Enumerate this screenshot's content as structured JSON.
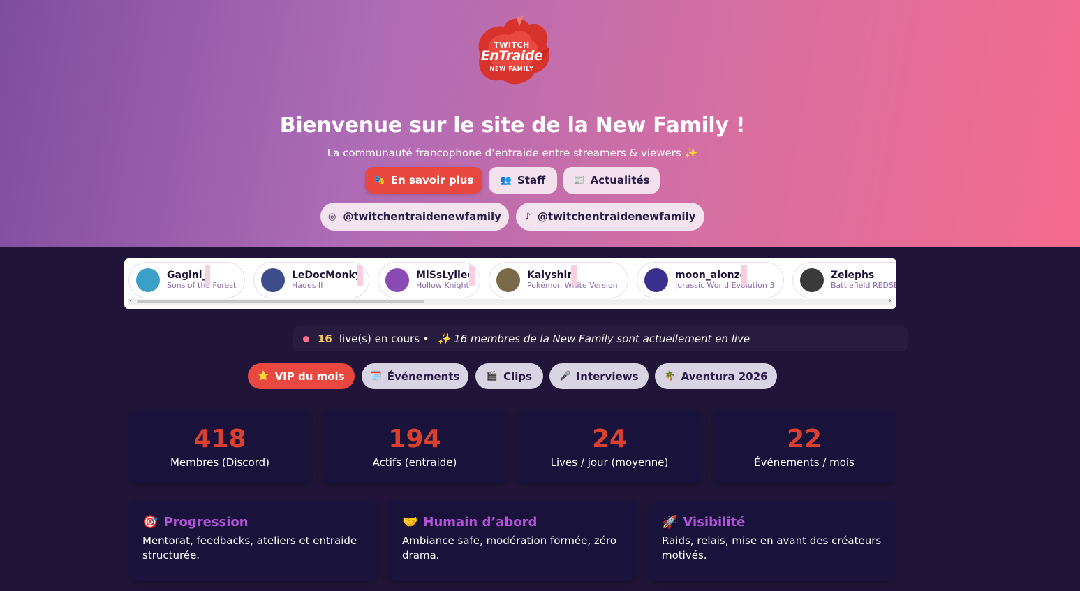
{
  "logo": {
    "line1": "TWITCH",
    "line2": "EnTraide",
    "line3": "NEW FAMILY"
  },
  "hero": {
    "title": "Bienvenue sur le site de la New Family !",
    "subtitle": "La communauté francophone d’entraide entre streamers & viewers ✨",
    "buttons": [
      {
        "icon": "🎭",
        "label": "En savoir plus"
      },
      {
        "icon": "👥",
        "label": "Staff"
      },
      {
        "icon": "📰",
        "label": "Actualités"
      }
    ],
    "socials": [
      {
        "icon": "instagram-icon",
        "glyph": "◎",
        "label": "@twitchentraidenewfamily"
      },
      {
        "icon": "tiktok-icon",
        "glyph": "♪",
        "label": "@twitchentraidenewfamily"
      }
    ]
  },
  "streamers": [
    {
      "name": "Gagini_",
      "game": "Sons of the Forest",
      "color": "#3aa0c7"
    },
    {
      "name": "LeDocMonky",
      "game": "Hades II",
      "color": "#3f4d8c"
    },
    {
      "name": "MiSsLyliee",
      "game": "Hollow Knight",
      "color": "#8b4bb5"
    },
    {
      "name": "Kalyshin",
      "game": "Pokémon White Version",
      "color": "#7a6a4a"
    },
    {
      "name": "moon_alonzo",
      "game": "Jurassic World Evolution 3",
      "color": "#3a2f8c"
    },
    {
      "name": "Zelephs",
      "game": "Battlefield REDSEC",
      "color": "#3a3a3a"
    }
  ],
  "live_bar": {
    "count": "16",
    "count_label": "live(s) en cours •",
    "message": "✨ 16 membres de la New Family sont actuellement en live"
  },
  "tabs": [
    {
      "icon": "⭐",
      "label": "VIP du mois",
      "active": true
    },
    {
      "icon": "🗓️",
      "label": "Événements",
      "active": false
    },
    {
      "icon": "🎬",
      "label": "Clips",
      "active": false
    },
    {
      "icon": "🎤",
      "label": "Interviews",
      "active": false
    },
    {
      "icon": "🌴",
      "label": "Aventura 2026",
      "active": false
    }
  ],
  "stats": [
    {
      "value": "418",
      "label": "Membres (Discord)"
    },
    {
      "value": "194",
      "label": "Actifs (entraide)"
    },
    {
      "value": "24",
      "label": "Lives / jour (moyenne)"
    },
    {
      "value": "22",
      "label": "Événements / mois"
    }
  ],
  "features": [
    {
      "icon": "🎯",
      "title": "Progression",
      "text": "Mentorat, feedbacks, ateliers et entraide structurée."
    },
    {
      "icon": "🤝",
      "title": "Humain d’abord",
      "text": "Ambiance safe, modération formée, zéro drama."
    },
    {
      "icon": "🚀",
      "title": "Visibilité",
      "text": "Raids, relais, mise en avant des créateurs motivés."
    }
  ],
  "colors": {
    "accent_red": "#e8483f",
    "stat_red": "#d9402f",
    "feature_purple": "#b153d6",
    "live_yellow": "#f7c85a"
  }
}
